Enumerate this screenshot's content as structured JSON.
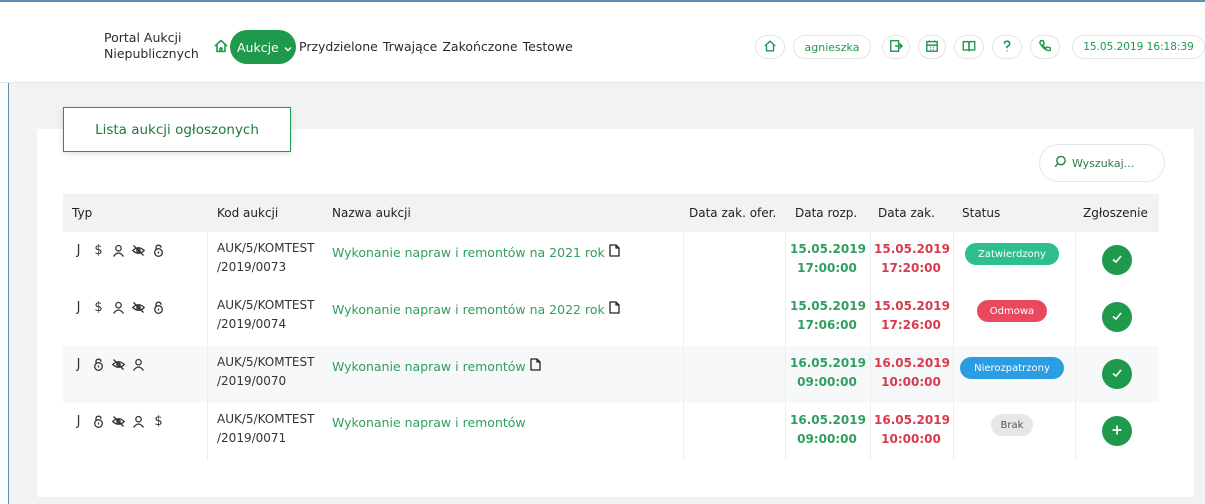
{
  "header": {
    "brand_line1": "Portal Aukcji",
    "brand_line2": "Niepublicznych",
    "nav_active": "Aukcje",
    "nav_links": [
      "Przydzielone",
      "Trwające",
      "Zakończone",
      "Testowe"
    ],
    "user": "agnieszka",
    "datetime": "15.05.2019 16:18:39"
  },
  "page": {
    "title": "Lista aukcji ogłoszonych",
    "search_placeholder": "Wyszukaj..."
  },
  "table": {
    "headers": [
      "Typ",
      "Kod aukcji",
      "Nazwa aukcji",
      "Data zak. ofer.",
      "Data rozp.",
      "Data zak.",
      "Status",
      "Zgłoszenie"
    ],
    "rows": [
      {
        "types": [
          "J",
          "$",
          "person",
          "eye-off",
          "lock"
        ],
        "code_line1": "AUK/5/KOMTEST",
        "code_line2": "/2019/0073",
        "name": "Wykonanie napraw i remontów na 2021 rok",
        "has_doc": true,
        "data_zak_ofer": "",
        "start_date": "15.05.2019",
        "start_time": "17:00:00",
        "end_date": "15.05.2019",
        "end_time": "17:20:00",
        "status": "Zatwierdzony",
        "action": "check"
      },
      {
        "types": [
          "J",
          "$",
          "person",
          "eye-off",
          "lock"
        ],
        "code_line1": "AUK/5/KOMTEST",
        "code_line2": "/2019/0074",
        "name": "Wykonanie napraw i remontów na 2022 rok",
        "has_doc": true,
        "data_zak_ofer": "",
        "start_date": "15.05.2019",
        "start_time": "17:06:00",
        "end_date": "15.05.2019",
        "end_time": "17:26:00",
        "status": "Odmowa",
        "action": "check"
      },
      {
        "types": [
          "J",
          "lock",
          "eye-off",
          "person"
        ],
        "code_line1": "AUK/5/KOMTEST",
        "code_line2": "/2019/0070",
        "name": "Wykonanie napraw i remontów",
        "has_doc": true,
        "data_zak_ofer": "",
        "start_date": "16.05.2019",
        "start_time": "09:00:00",
        "end_date": "16.05.2019",
        "end_time": "10:00:00",
        "status": "Nierozpatrzony",
        "action": "check"
      },
      {
        "types": [
          "J",
          "lock",
          "eye-off",
          "person",
          "$"
        ],
        "code_line1": "AUK/5/KOMTEST",
        "code_line2": "/2019/0071",
        "name": "Wykonanie napraw i remontów",
        "has_doc": false,
        "data_zak_ofer": "",
        "start_date": "16.05.2019",
        "start_time": "09:00:00",
        "end_date": "16.05.2019",
        "end_time": "10:00:00",
        "status": "Brak",
        "action": "plus"
      }
    ]
  },
  "colors": {
    "accent": "#1f9a4d",
    "date_start": "#2f9e5f",
    "date_end": "#d83b4d",
    "status_zatwierdzony": "#2dbf8f",
    "status_odmowa": "#e8495f",
    "status_nierozpatrzony": "#2b9ee3",
    "status_brak": "#e6e7e9"
  }
}
